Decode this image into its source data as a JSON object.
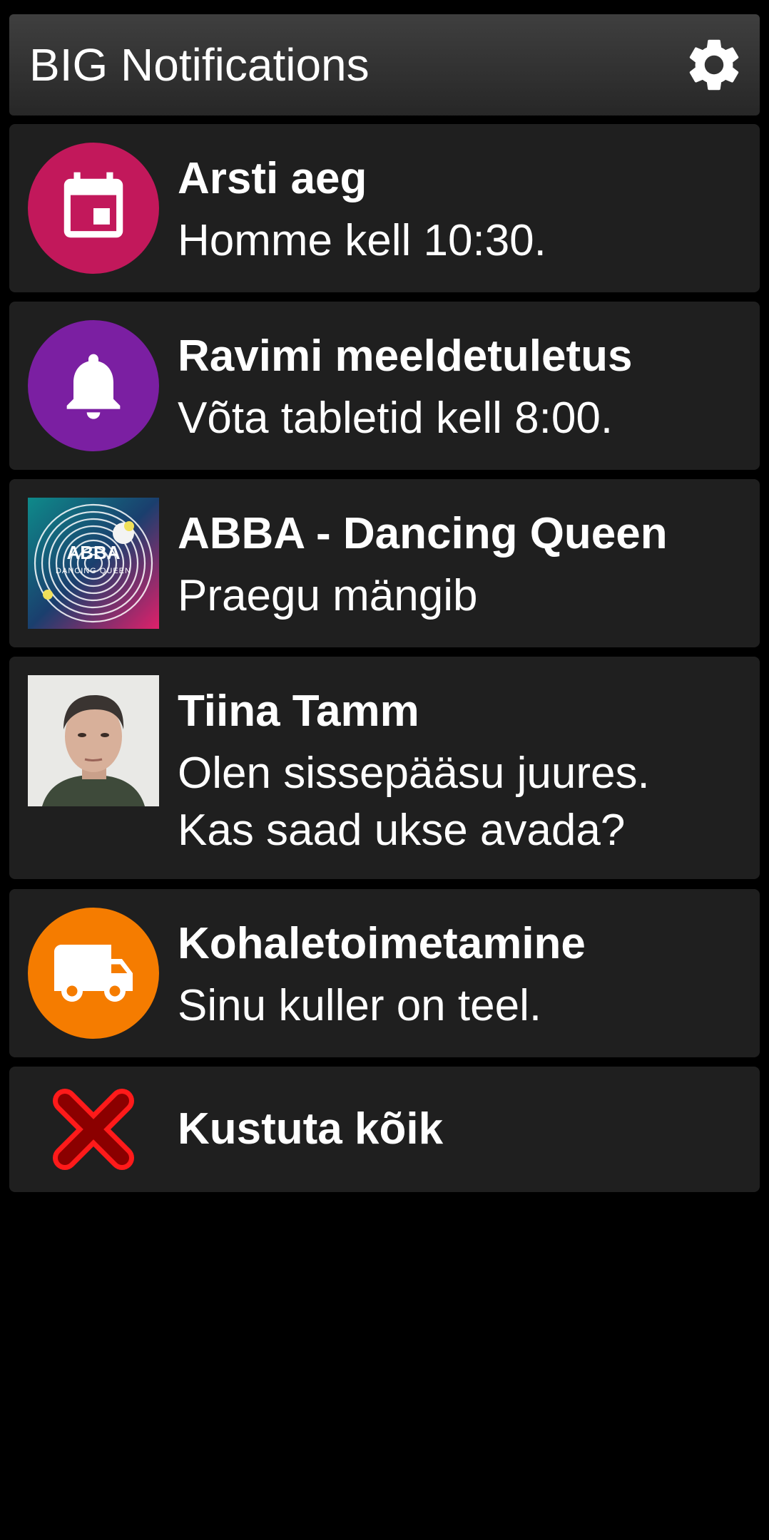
{
  "app": {
    "title": "BIG Notifications",
    "settings_icon": "gear-icon"
  },
  "colors": {
    "background": "#000000",
    "card": "#1f1f1f",
    "header": "#333333",
    "calendar_accent": "#c2185b",
    "bell_accent": "#7b1fa2",
    "truck_accent": "#f57c00",
    "clear_accent": "#d50000"
  },
  "notifications": [
    {
      "title": "Arsti aeg",
      "body": [
        "Homme kell 10:30."
      ],
      "icon": "calendar-icon"
    },
    {
      "title": "Ravimi meeldetuletus",
      "body": [
        "Võta tabletid kell 8:00."
      ],
      "icon": "bell-icon"
    },
    {
      "title": "ABBA - Dancing Queen",
      "body": [
        "Praegu mängib"
      ],
      "icon": "album-art",
      "art_text": [
        "ABBA",
        "DANCING QUEEN"
      ]
    },
    {
      "title": "Tiina Tamm",
      "body": [
        "Olen sissepääsu juures.",
        "Kas saad ukse avada?"
      ],
      "icon": "contact-photo"
    },
    {
      "title": "Kohaletoimetamine",
      "body": [
        "Sinu kuller on teel."
      ],
      "icon": "truck-icon"
    }
  ],
  "clear_all": {
    "label": "Kustuta kõik",
    "icon": "close-icon"
  }
}
